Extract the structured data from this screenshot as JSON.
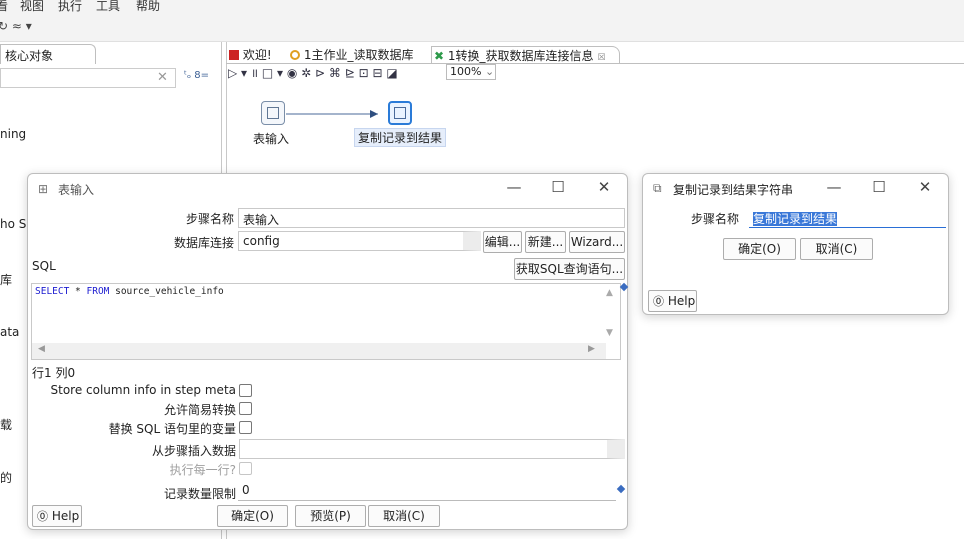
{
  "menu": {
    "items": [
      "看",
      "视图",
      "执行",
      "工具",
      "帮助"
    ]
  },
  "toolbar": {
    "left_icons": "↻  ≈ ▾"
  },
  "left_panel": {
    "tab_label": "核心对象",
    "search_clear": "✕",
    "tree_icons": "ᵗₒ 8=",
    "partial_items": [
      "ning",
      "ho Se",
      "库",
      "ata",
      "载",
      "的"
    ]
  },
  "editor_tabs": [
    {
      "label": "欢迎!",
      "icon_color": "#cc2222"
    },
    {
      "label": "1主作业_读取数据库",
      "icon_color": "#e0a020"
    },
    {
      "label": "1转换_获取数据库连接信息",
      "icon_color": "#2e9a4a",
      "close": "☒"
    }
  ],
  "canvas_toolbar": {
    "icons": "▷ ▾ ॥ □ ▾ ◉ ✲ ⊳  ⌘ ⊵ ⊡ ⊟  ◪",
    "zoom": "100%",
    "zoom_caret": "⌄"
  },
  "canvas": {
    "node1_label": "表输入",
    "node2_label": "复制记录到结果"
  },
  "dialog_table_input": {
    "title": "表输入",
    "step_name_label": "步骤名称",
    "step_name_value": "表输入",
    "db_conn_label": "数据库连接",
    "db_conn_value": "config",
    "edit_button": "编辑...",
    "new_button": "新建...",
    "wizard_button": "Wizard...",
    "sql_label": "SQL",
    "get_sql_button": "获取SQL查询语句...",
    "sql_keyword1": "SELECT",
    "sql_star": " * ",
    "sql_keyword2": "FROM",
    "sql_table": " source_vehicle_info",
    "status": "行1 列0",
    "store_column_label": "Store column info in step meta",
    "lazy_conversion_label": "允许简易转换",
    "replace_vars_label": "替换 SQL 语句里的变量",
    "insert_from_step_label": "从步骤插入数据",
    "execute_each_row_label": "执行每一行?",
    "limit_label": "记录数量限制",
    "limit_value": "0",
    "help_button": "Help",
    "ok_button": "确定(O)",
    "preview_button": "预览(P)",
    "cancel_button": "取消(C)",
    "minimize": "—",
    "maximize": "☐",
    "close": "✕"
  },
  "dialog_copy_rows": {
    "title": "复制记录到结果字符串",
    "step_name_label": "步骤名称",
    "step_name_value": "复制记录到结果",
    "ok_button": "确定(O)",
    "cancel_button": "取消(C)",
    "help_button": "Help",
    "minimize": "—",
    "maximize": "☐",
    "close": "✕"
  }
}
